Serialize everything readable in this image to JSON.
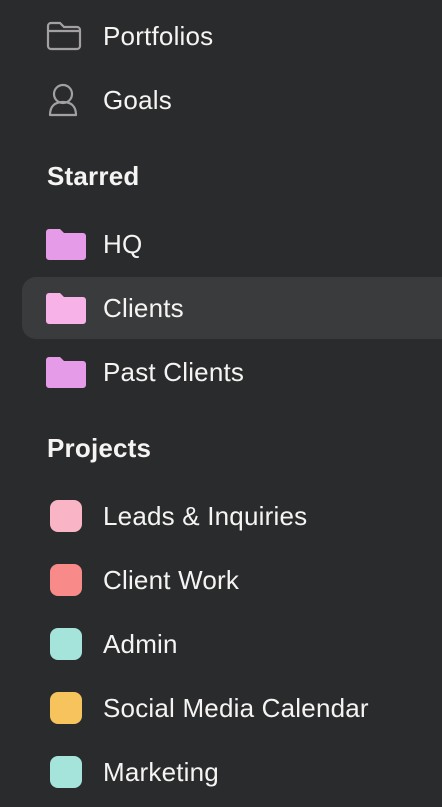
{
  "nav": {
    "portfolios": {
      "label": "Portfolios",
      "icon": "folder-outline-icon"
    },
    "goals": {
      "label": "Goals",
      "icon": "goals-person-icon"
    }
  },
  "starred": {
    "heading": "Starred",
    "items": [
      {
        "label": "HQ",
        "icon": "folder-icon",
        "color": "#e59be8"
      },
      {
        "label": "Clients",
        "icon": "folder-icon",
        "color": "#f7b2e8",
        "selected": true
      },
      {
        "label": "Past Clients",
        "icon": "folder-icon",
        "color": "#e59be8"
      }
    ]
  },
  "projects": {
    "heading": "Projects",
    "items": [
      {
        "label": "Leads & Inquiries",
        "color": "#f9b5c6"
      },
      {
        "label": "Client Work",
        "color": "#f88a8a"
      },
      {
        "label": "Admin",
        "color": "#a4e4db"
      },
      {
        "label": "Social Media Calendar",
        "color": "#f7c35c"
      },
      {
        "label": "Marketing",
        "color": "#a4e4db"
      }
    ]
  },
  "colors": {
    "background": "#2a2b2d",
    "selected_row": "#3a3b3d",
    "text": "#f5f4f3",
    "outline_icon": "#a2a0a2"
  }
}
